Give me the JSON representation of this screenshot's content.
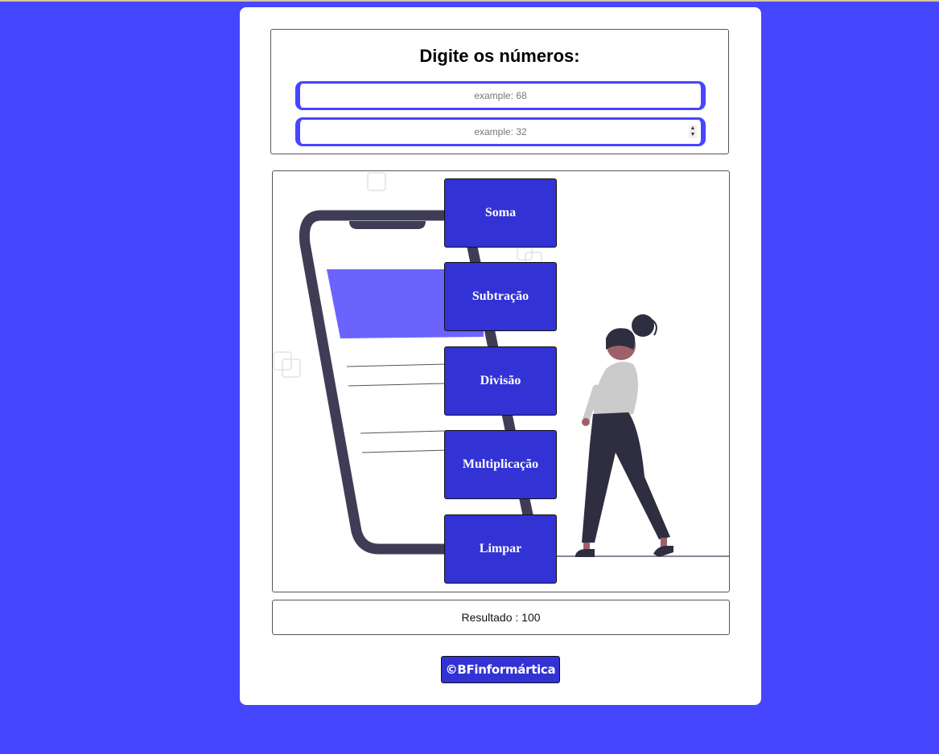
{
  "form": {
    "heading": "Digite os números:",
    "first_number_placeholder": "example: 68",
    "second_number_placeholder": "example: 32"
  },
  "operations": {
    "sum_label": "Soma",
    "subtract_label": "Subtração",
    "divide_label": "Divisão",
    "multiply_label": "Multiplicação",
    "clear_label": "Limpar"
  },
  "result": {
    "text": "Resultado : 100"
  },
  "footer": {
    "brand": "©BFinformártica"
  },
  "colors": {
    "page_background": "#4646ff",
    "button_fill": "#3232d5",
    "illustration_accent": "#6c63ff",
    "phone_frame": "#3f3d56"
  }
}
